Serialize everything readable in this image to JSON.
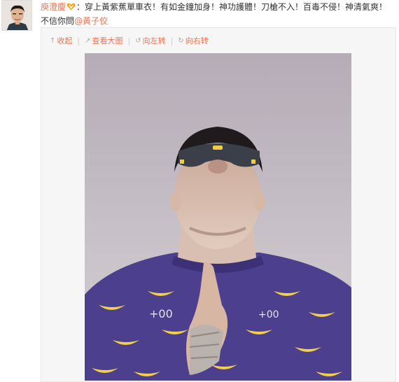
{
  "post": {
    "author": "庾澄慶",
    "text": "：穿上黃紫蕉單車衣！有如金鐘加身！神功護體！刀槍不入！百毒不侵！神清氣爽！不信你問",
    "mention": "@黃子佼",
    "vip_icon": "heart-v-icon"
  },
  "toolbar": {
    "collapse_label": "收起",
    "view_large_label": "查看大图",
    "rotate_left_label": "向左转",
    "rotate_right_label": "向右转"
  },
  "colors": {
    "link": "#eb7350",
    "sky": "#b9b0bb",
    "jersey": "#4b3f8e",
    "banana": "#f4d04a"
  }
}
